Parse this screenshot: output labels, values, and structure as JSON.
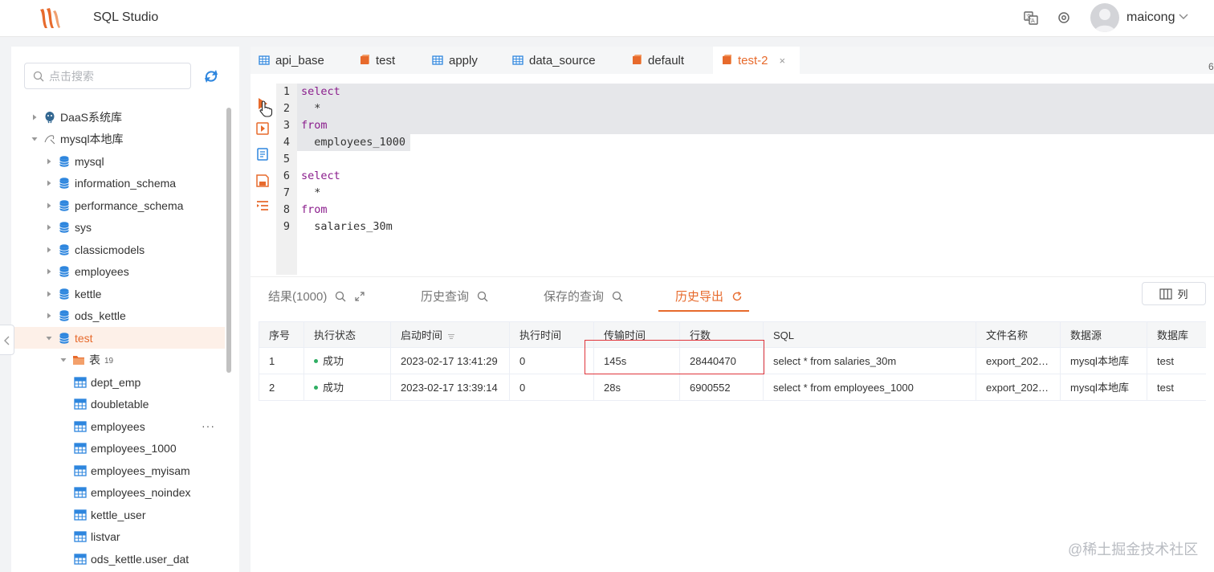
{
  "app": {
    "title": "SQL Studio",
    "user": "maicong",
    "brand_color": "#e76a2c"
  },
  "sidebar": {
    "search_placeholder": "点击搜索",
    "tree": [
      {
        "label": "DaaS系统库",
        "depth": 0,
        "icon": "postgres-icon",
        "expanded": false
      },
      {
        "label": "mysql本地库",
        "depth": 0,
        "icon": "mysql-icon",
        "expanded": true
      },
      {
        "label": "mysql",
        "depth": 1,
        "icon": "database-icon"
      },
      {
        "label": "information_schema",
        "depth": 1,
        "icon": "database-icon"
      },
      {
        "label": "performance_schema",
        "depth": 1,
        "icon": "database-icon"
      },
      {
        "label": "sys",
        "depth": 1,
        "icon": "database-icon"
      },
      {
        "label": "classicmodels",
        "depth": 1,
        "icon": "database-icon"
      },
      {
        "label": "employees",
        "depth": 1,
        "icon": "database-icon"
      },
      {
        "label": "kettle",
        "depth": 1,
        "icon": "database-icon"
      },
      {
        "label": "ods_kettle",
        "depth": 1,
        "icon": "database-icon"
      },
      {
        "label": "test",
        "depth": 1,
        "icon": "database-icon",
        "expanded": true,
        "selected": true
      },
      {
        "label": "表",
        "badge": "19",
        "depth": 2,
        "icon": "folder-icon",
        "expanded": true
      },
      {
        "label": "dept_emp",
        "depth": 3,
        "icon": "table-icon"
      },
      {
        "label": "doubletable",
        "depth": 3,
        "icon": "table-icon"
      },
      {
        "label": "employees",
        "depth": 3,
        "icon": "table-icon",
        "more": "···"
      },
      {
        "label": "employees_1000",
        "depth": 3,
        "icon": "table-icon"
      },
      {
        "label": "employees_myisam",
        "depth": 3,
        "icon": "table-icon"
      },
      {
        "label": "employees_noindex",
        "depth": 3,
        "icon": "table-icon"
      },
      {
        "label": "kettle_user",
        "depth": 3,
        "icon": "table-icon"
      },
      {
        "label": "listvar",
        "depth": 3,
        "icon": "table-icon"
      },
      {
        "label": "ods_kettle.user_dat",
        "depth": 3,
        "icon": "table-icon"
      }
    ]
  },
  "tabs": [
    {
      "label": "api_base",
      "icon": "table-icon"
    },
    {
      "label": "test",
      "icon": "query-icon"
    },
    {
      "label": "apply",
      "icon": "table-icon"
    },
    {
      "label": "data_source",
      "icon": "table-icon"
    },
    {
      "label": "default",
      "icon": "query-icon"
    },
    {
      "label": "test-2",
      "icon": "query-icon",
      "active": true,
      "close": "×"
    }
  ],
  "tab_extra": "6",
  "editor": {
    "lines": [
      {
        "n": "1",
        "text": "select",
        "kw": true
      },
      {
        "n": "2",
        "text": "  *",
        "kw": false
      },
      {
        "n": "3",
        "text": "from",
        "kw": true
      },
      {
        "n": "4",
        "text": "  employees_1000",
        "kw": false
      },
      {
        "n": "5",
        "text": "",
        "kw": false
      },
      {
        "n": "6",
        "text": "select",
        "kw": true
      },
      {
        "n": "7",
        "text": "  *",
        "kw": false
      },
      {
        "n": "8",
        "text": "from",
        "kw": true
      },
      {
        "n": "9",
        "text": "  salaries_30m",
        "kw": false
      }
    ]
  },
  "result_tabs": {
    "results": "结果(1000)",
    "history_query": "历史查询",
    "saved_query": "保存的查询",
    "history_export": "历史导出",
    "columns_button": "列"
  },
  "table": {
    "columns": [
      "序号",
      "执行状态",
      "启动时间",
      "执行时间",
      "传输时间",
      "行数",
      "SQL",
      "文件名称",
      "数据源",
      "数据库"
    ],
    "rows": [
      [
        "1",
        "成功",
        "2023-02-17 13:41:29",
        "0",
        "145s",
        "28440470",
        "select * from salaries_30m",
        "export_202…",
        "mysql本地库",
        "test"
      ],
      [
        "2",
        "成功",
        "2023-02-17 13:39:14",
        "0",
        "28s",
        "6900552",
        "select * from employees_1000",
        "export_202…",
        "mysql本地库",
        "test"
      ]
    ],
    "status_color": "#2fae63"
  },
  "watermark": "@稀土掘金技术社区"
}
